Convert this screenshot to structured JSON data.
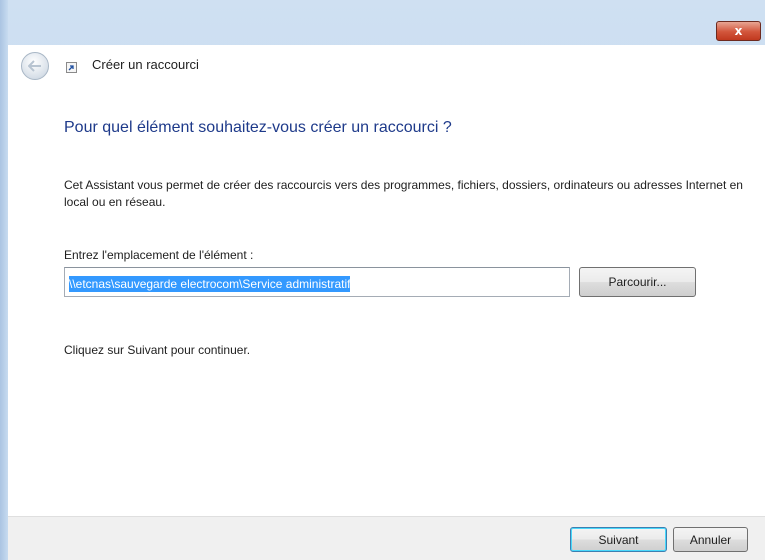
{
  "window": {
    "close_glyph": "x"
  },
  "wizard": {
    "title": "Créer un raccourci",
    "heading": "Pour quel élément souhaitez-vous créer un raccourci ?",
    "description": "Cet Assistant vous permet de créer des raccourcis vers des programmes, fichiers, dossiers, ordinateurs ou adresses Internet en local ou en réseau.",
    "field_label": "Entrez l'emplacement de l'élément :",
    "location_value": "\\\\etcnas\\sauvegarde electrocom\\Service administratif",
    "browse_label": "Parcourir...",
    "continue_text": "Cliquez sur Suivant pour continuer."
  },
  "footer": {
    "next_label": "Suivant",
    "cancel_label": "Annuler"
  },
  "colors": {
    "heading": "#1e3a8a",
    "selection": "#3399ff",
    "close_button": "#d2553b"
  },
  "icons": {
    "back": "back-arrow-icon",
    "wizard": "shortcut-icon",
    "close": "close-icon"
  }
}
